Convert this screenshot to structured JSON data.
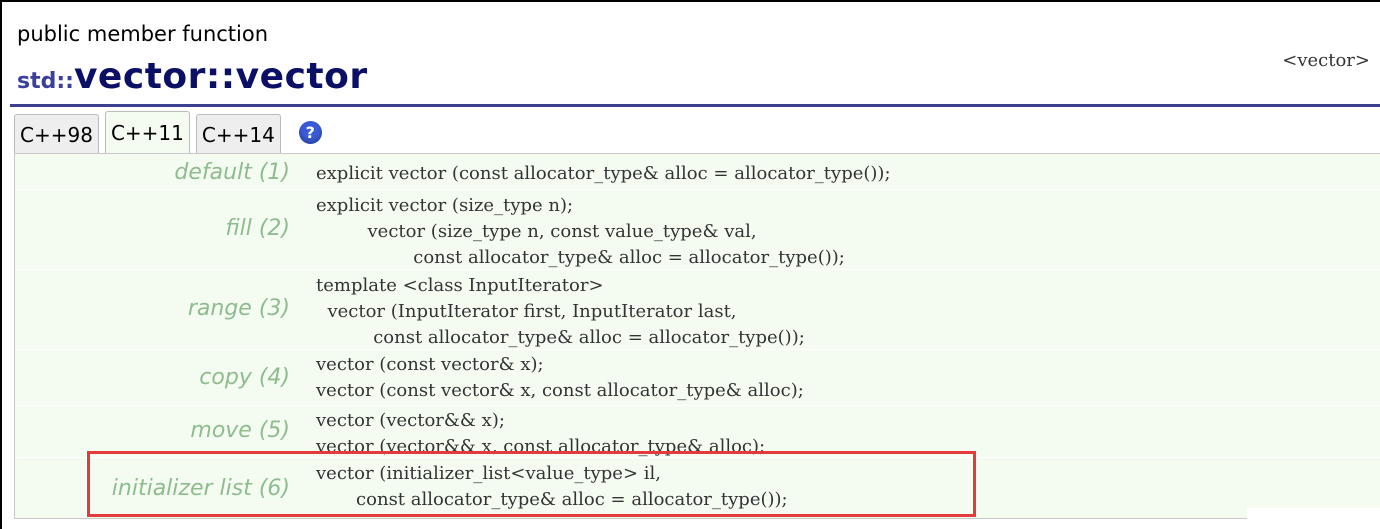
{
  "page": {
    "kind": "public member function",
    "title_ns": "std::",
    "title_class": "vector",
    "title_rest": "::vector",
    "header_file": "<vector>"
  },
  "tabs": [
    {
      "label": "C++98",
      "active": false
    },
    {
      "label": "C++11",
      "active": true
    },
    {
      "label": "C++14",
      "active": false
    }
  ],
  "help_icon": {
    "glyph": "?",
    "name": "help-icon"
  },
  "overloads": [
    {
      "label": "default (1)",
      "code": "explicit vector (const allocator_type& alloc = allocator_type());"
    },
    {
      "label": "fill (2)",
      "code": "explicit vector (size_type n);\n         vector (size_type n, const value_type& val,\n                 const allocator_type& alloc = allocator_type());"
    },
    {
      "label": "range (3)",
      "code": "template <class InputIterator>\n  vector (InputIterator first, InputIterator last,\n          const allocator_type& alloc = allocator_type());"
    },
    {
      "label": "copy (4)",
      "code": "vector (const vector& x);\nvector (const vector& x, const allocator_type& alloc);"
    },
    {
      "label": "move (5)",
      "code": "vector (vector&& x);\nvector (vector&& x, const allocator_type& alloc);"
    },
    {
      "label": "initializer list (6)",
      "code": "vector (initializer_list<value_type> il,\n       const allocator_type& alloc = allocator_type());"
    }
  ],
  "colors": {
    "title": "#0b1066",
    "rule": "#3b4190",
    "label": "#8fbc8f",
    "panel_bg": "#f4fcf2",
    "highlight": "#e33b3b"
  }
}
